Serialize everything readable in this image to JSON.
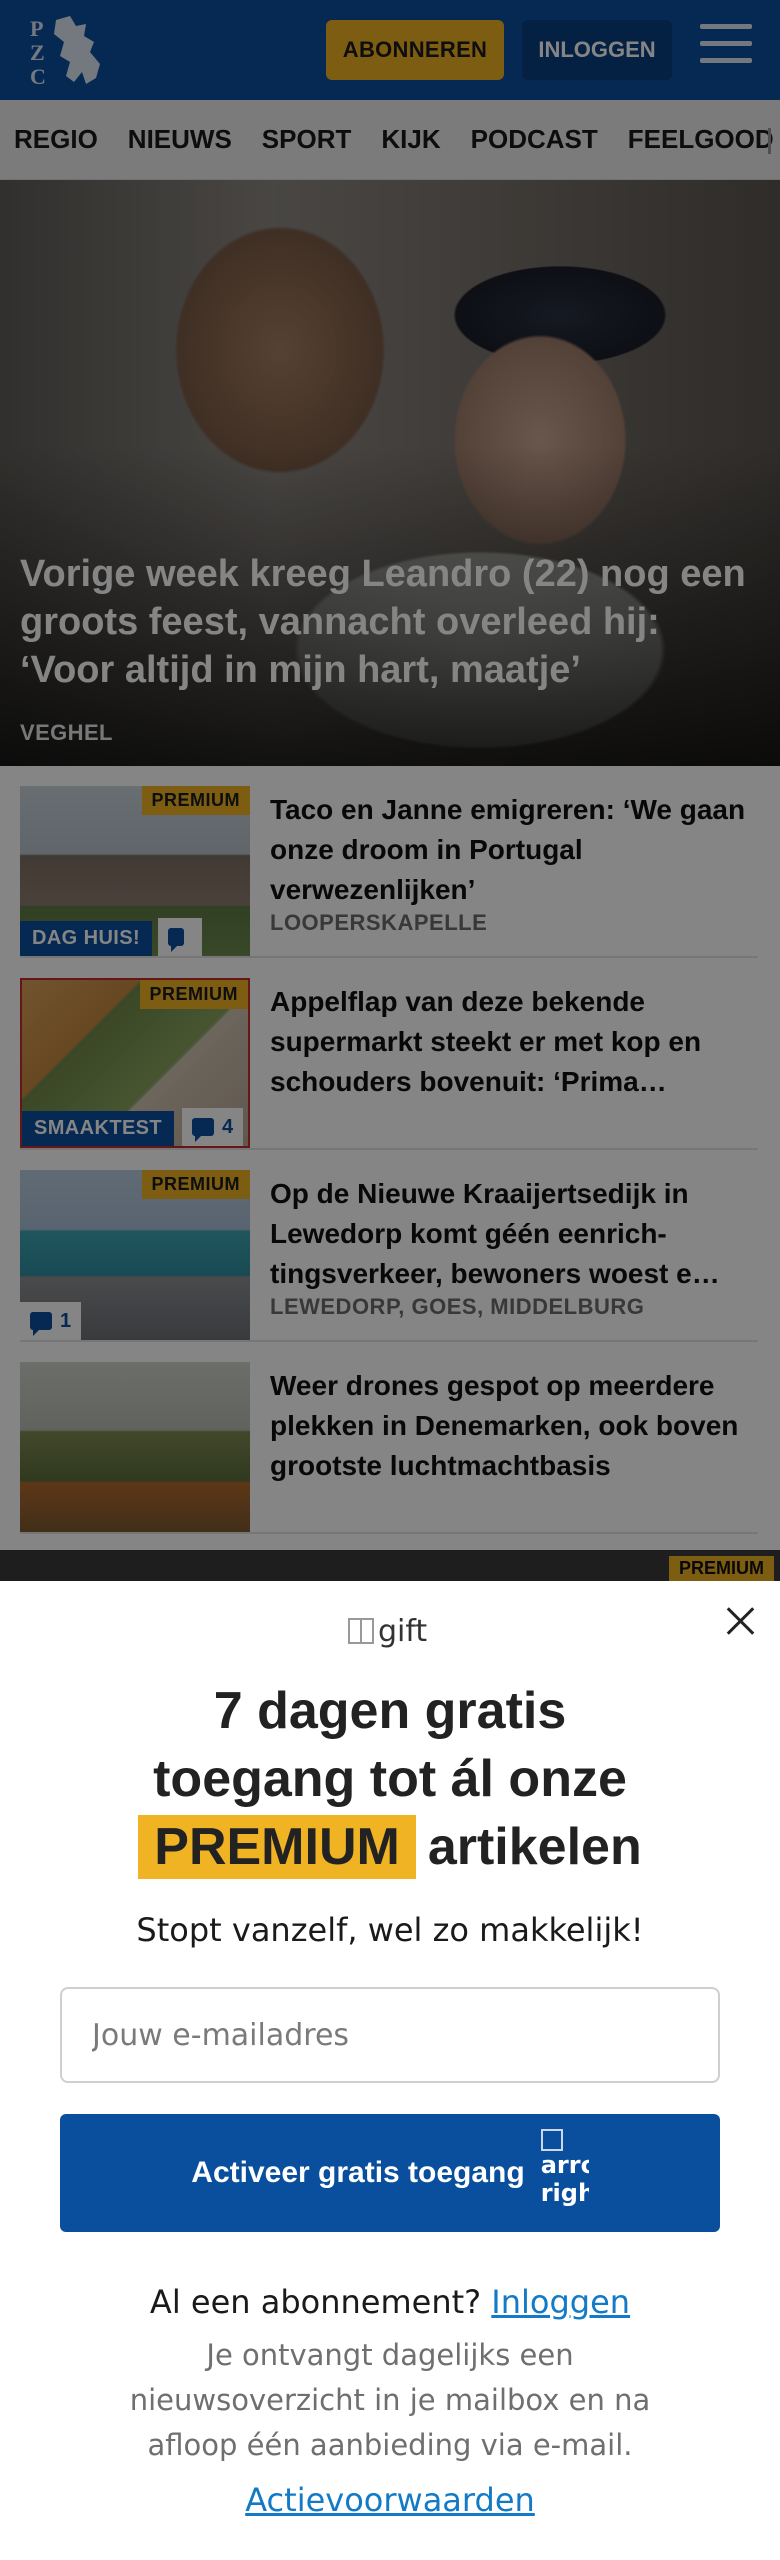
{
  "header": {
    "logo_text": "PZC",
    "subscribe_label": "ABONNEREN",
    "login_label": "INLOGGEN",
    "menu_icon": "hamburger-icon"
  },
  "nav": {
    "items": [
      "REGIO",
      "NIEUWS",
      "SPORT",
      "KIJK",
      "PODCAST",
      "FEELGOOD"
    ]
  },
  "hero": {
    "title": "Vorige week kreeg Leandro (22) nog een groots feest, vannacht overleed hij: ‘Voor altijd in mijn hart, maatje’",
    "location": "VEGHEL"
  },
  "articles": [
    {
      "badge": "PREMIUM",
      "label": "DAG HUIS!",
      "comments": "",
      "title": "Taco en Janne emigreren: ‘We gaan onze droom in Portugal verwezenlijken’",
      "location": "LOOPERSKAPELLE"
    },
    {
      "badge": "PREMIUM",
      "label": "SMAAKTEST",
      "comments": "4",
      "title": "Appelflap van deze bekende supermarkt steekt er met kop en schouders bovenuit: ‘Prima…",
      "location": ""
    },
    {
      "badge": "PREMIUM",
      "label": "",
      "comments": "1",
      "title": "Op de Nieuwe Kraaijertsedijk in Lewedorp komt géén eenrich-tingsverkeer, bewoners woest e…",
      "location": "LEWEDORP, GOES, MIDDELBURG"
    },
    {
      "badge": "",
      "label": "",
      "comments": "",
      "title": "Weer drones gespot op meerdere plekken in Denemarken, ook boven grootste luchtmachtbasis",
      "location": ""
    }
  ],
  "peek_badge": "PREMIUM",
  "modal": {
    "gift_alt": "gift",
    "headline_line1": "7 dagen gratis",
    "headline_line2": "toegang tot ál onze",
    "headline_premium": "PREMIUM",
    "headline_tail": "artikelen",
    "subline": "Stopt vanzelf, wel zo makkelijk!",
    "email_placeholder": "Jouw e-mailadres",
    "cta_label": "Activeer gratis toegang",
    "arrow_alt": "arrow-right",
    "have_subscription": "Al een abonnement?",
    "login_link": "Inloggen",
    "info": "Je ontvangt dagelijks een nieuwsoverzicht in je mailbox en na afloop één aanbieding via e-mail.",
    "terms_link": "Actievoorwaarden"
  },
  "colors": {
    "brand_blue": "#0a4f9e",
    "premium_yellow": "#f0b323",
    "link_blue": "#127ac7"
  }
}
